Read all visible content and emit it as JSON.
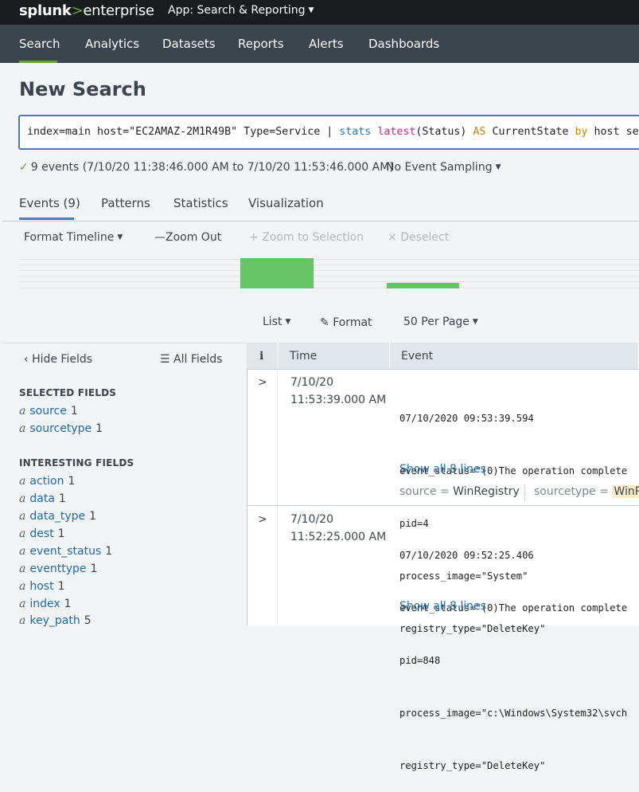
{
  "topbar": {
    "logo_brand": "splunk",
    "logo_gt": ">",
    "logo_product": "enterprise",
    "app_label": "App: Search & Reporting"
  },
  "nav": {
    "items": [
      "Search",
      "Analytics",
      "Datasets",
      "Reports",
      "Alerts",
      "Dashboards"
    ],
    "active": "Search"
  },
  "page": {
    "title": "New Search"
  },
  "search": {
    "query_part1": "index=main host=\"EC2AMAZ-2M1R49B\" Type=Service | ",
    "query_stats": "stats",
    "query_latest": "latest",
    "query_part2": "(Status) ",
    "query_as": "AS",
    "query_part3": " CurrentState ",
    "query_by": "by",
    "query_part4": " host servic"
  },
  "status": {
    "events_text": "9 events (7/10/20 11:38:46.000 AM to 7/10/20 11:53:46.000 AM)",
    "sampling": "No Event Sampling"
  },
  "tabs": {
    "events": "Events (9)",
    "patterns": "Patterns",
    "statistics": "Statistics",
    "visualization": "Visualization"
  },
  "timeline": {
    "format": "Format Timeline",
    "zoom_out": "Zoom Out",
    "zoom_sel": "Zoom to Selection",
    "deselect": "Deselect"
  },
  "results_toolbar": {
    "list": "List",
    "format": "Format",
    "per_page": "50 Per Page"
  },
  "fields": {
    "hide": "Hide Fields",
    "all": "All Fields",
    "selected_heading": "SELECTED FIELDS",
    "selected": [
      {
        "type": "a",
        "name": "source",
        "count": "1"
      },
      {
        "type": "a",
        "name": "sourcetype",
        "count": "1"
      }
    ],
    "interesting_heading": "INTERESTING FIELDS",
    "interesting": [
      {
        "type": "a",
        "name": "action",
        "count": "1"
      },
      {
        "type": "a",
        "name": "data",
        "count": "1"
      },
      {
        "type": "a",
        "name": "data_type",
        "count": "1"
      },
      {
        "type": "a",
        "name": "dest",
        "count": "1"
      },
      {
        "type": "a",
        "name": "event_status",
        "count": "1"
      },
      {
        "type": "a",
        "name": "eventtype",
        "count": "1"
      },
      {
        "type": "a",
        "name": "host",
        "count": "1"
      },
      {
        "type": "a",
        "name": "index",
        "count": "1"
      },
      {
        "type": "a",
        "name": "key_path",
        "count": "5"
      }
    ]
  },
  "table": {
    "col_info": "i",
    "col_time": "Time",
    "col_event": "Event"
  },
  "events": [
    {
      "date": "7/10/20",
      "time": "11:53:39.000 AM",
      "lines": [
        "07/10/2020 09:53:39.594",
        "event_status=\"(0)The operation complete",
        "pid=4",
        "process_image=\"System\"",
        "registry_type=\"DeleteKey\""
      ],
      "show_all": "Show all 8 lines",
      "source_key": "source =",
      "source_val": "WinRegistry",
      "sourcetype_key": "sourcetype =",
      "sourcetype_val": "WinRe"
    },
    {
      "date": "7/10/20",
      "time": "11:52:25.000 AM",
      "lines": [
        "07/10/2020 09:52:25.406",
        "event_status=\"(0)The operation complete",
        "pid=848",
        "process_image=\"c:\\Windows\\System32\\svch",
        "registry_type=\"DeleteKey\""
      ],
      "show_all": "Show all 8 lines"
    }
  ]
}
